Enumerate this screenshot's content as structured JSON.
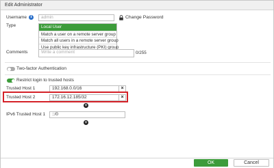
{
  "window": {
    "title": "Edit Administrator"
  },
  "username": {
    "label": "Username",
    "value": "admin",
    "change_password": "Change Password"
  },
  "type": {
    "label": "Type",
    "options": [
      "Local User",
      "Match a user on a remote server group",
      "Match all users in a remote server group",
      "Use public key infrastructure (PKI) group"
    ],
    "selected": "Local User"
  },
  "comments": {
    "label": "Comments",
    "placeholder": "Write a comment",
    "counter": "0/255"
  },
  "two_factor": {
    "label": "Two-factor Authentication",
    "enabled": false
  },
  "restrict": {
    "label": "Restrict login to trusted hosts",
    "enabled": true,
    "hosts": [
      {
        "label": "Trusted Host 1",
        "value": "192.168.0.0/16"
      },
      {
        "label": "Trusted Host 2",
        "value": "172.16.12.185/32"
      }
    ],
    "ipv6": {
      "label": "IPv6 Trusted Host 1",
      "value": "::/0"
    }
  },
  "footer": {
    "ok": "OK",
    "cancel": "Cancel"
  },
  "colors": {
    "accent": "#3d9c3b",
    "highlight": "#d42027",
    "info": "#2a6fc9"
  },
  "icons": {
    "info": "info-icon",
    "lock": "lock-icon",
    "remove": "close-icon",
    "add": "plus-circle-icon"
  }
}
